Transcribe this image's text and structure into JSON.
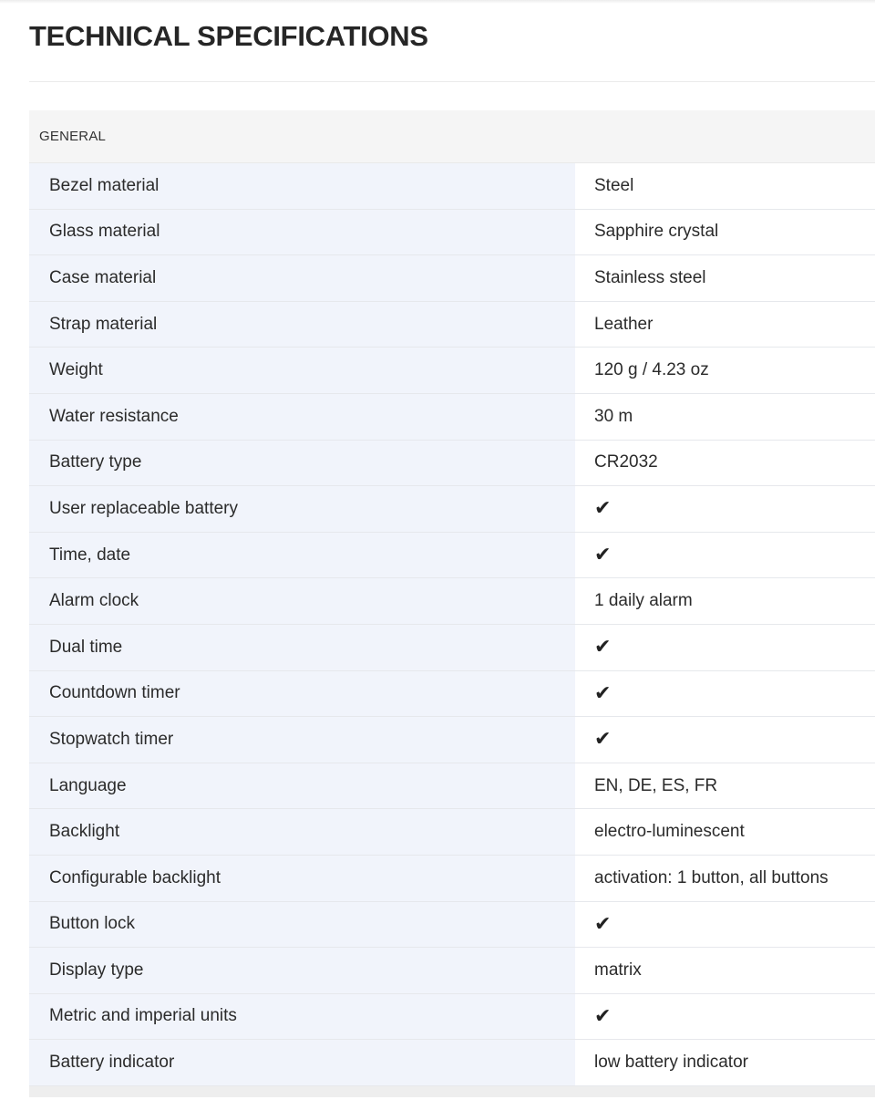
{
  "page": {
    "title": "TECHNICAL SPECIFICATIONS"
  },
  "section": {
    "header": "GENERAL"
  },
  "check_glyph": "✔",
  "specs": [
    {
      "label": "Bezel material",
      "value": "Steel"
    },
    {
      "label": "Glass material",
      "value": "Sapphire crystal"
    },
    {
      "label": "Case material",
      "value": "Stainless steel"
    },
    {
      "label": "Strap material",
      "value": "Leather"
    },
    {
      "label": "Weight",
      "value": "120 g / 4.23 oz"
    },
    {
      "label": "Water resistance",
      "value": "30 m"
    },
    {
      "label": "Battery type",
      "value": "CR2032"
    },
    {
      "label": "User replaceable battery",
      "value": "✔"
    },
    {
      "label": "Time, date",
      "value": "✔"
    },
    {
      "label": "Alarm clock",
      "value": "1 daily alarm"
    },
    {
      "label": "Dual time",
      "value": "✔"
    },
    {
      "label": "Countdown timer",
      "value": "✔"
    },
    {
      "label": "Stopwatch timer",
      "value": "✔"
    },
    {
      "label": "Language",
      "value": "EN, DE, ES, FR"
    },
    {
      "label": "Backlight",
      "value": "electro-luminescent"
    },
    {
      "label": "Configurable backlight",
      "value": "activation: 1 button, all buttons"
    },
    {
      "label": "Button lock",
      "value": "✔"
    },
    {
      "label": "Display type",
      "value": "matrix"
    },
    {
      "label": "Metric and imperial units",
      "value": "✔"
    },
    {
      "label": "Battery indicator",
      "value": "low battery indicator"
    }
  ],
  "colors": {
    "label_bg": "#f1f4fb",
    "header_bg": "#f5f5f5",
    "text": "#2b2b2b"
  }
}
